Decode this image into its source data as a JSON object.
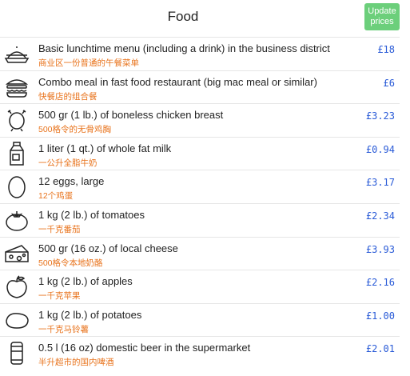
{
  "header": {
    "title": "Food",
    "update_button": "Update prices"
  },
  "items": [
    {
      "icon": "lunch-tray-icon",
      "name": "Basic lunchtime menu (including a drink) in the business district",
      "zh": "商业区一份普通的午餐菜单",
      "price": "£18"
    },
    {
      "icon": "burger-icon",
      "name": "Combo meal in fast food restaurant (big mac meal or similar)",
      "zh": "快餐店的组合餐",
      "price": "£6"
    },
    {
      "icon": "chicken-icon",
      "name": "500 gr (1 lb.) of boneless chicken breast",
      "zh": "500格令的无骨鸡胸",
      "price": "£3.23"
    },
    {
      "icon": "milk-carton-icon",
      "name": "1 liter (1 qt.) of whole fat milk",
      "zh": "一公升全脂牛奶",
      "price": "£0.94"
    },
    {
      "icon": "egg-icon",
      "name": "12 eggs, large",
      "zh": "12个鸡蛋",
      "price": "£3.17"
    },
    {
      "icon": "tomato-icon",
      "name": "1 kg (2 lb.) of tomatoes",
      "zh": "一千克番茄",
      "price": "£2.34"
    },
    {
      "icon": "cheese-icon",
      "name": "500 gr (16 oz.) of local cheese",
      "zh": "500格令本地奶酪",
      "price": "£3.93"
    },
    {
      "icon": "apple-icon",
      "name": "1 kg (2 lb.) of apples",
      "zh": "一千克苹果",
      "price": "£2.16"
    },
    {
      "icon": "potato-icon",
      "name": "1 kg (2 lb.) of potatoes",
      "zh": "一千克马铃薯",
      "price": "£1.00"
    },
    {
      "icon": "beer-can-icon",
      "name": "0.5 l (16 oz) domestic beer in the supermarket",
      "zh": "半升超市的国内啤酒",
      "price": "£2.01"
    }
  ]
}
